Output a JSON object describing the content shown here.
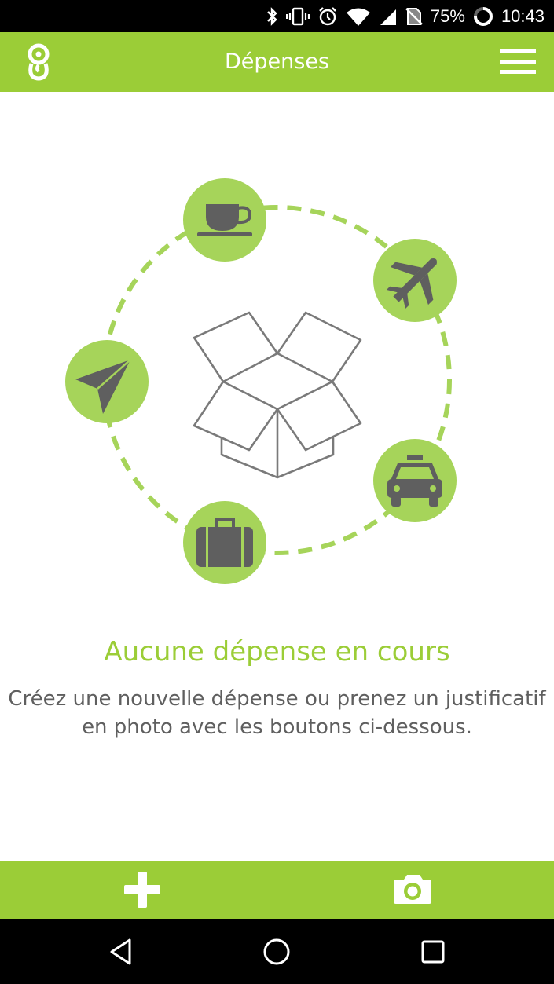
{
  "status_bar": {
    "battery_percent": "75%",
    "time": "10:43",
    "icons": [
      "bluetooth-icon",
      "vibrate-icon",
      "alarm-icon",
      "wifi-icon",
      "cellular-signal-icon",
      "no-sim-icon",
      "battery-icon"
    ]
  },
  "app_bar": {
    "title": "Dépenses",
    "logo_icon": "app-logo-icon",
    "menu_icon": "hamburger-menu-icon"
  },
  "illustration": {
    "center_icon": "open-box-icon",
    "category_icons": [
      "coffee-cup-icon",
      "airplane-icon",
      "taxi-icon",
      "suitcase-icon",
      "paper-plane-icon"
    ]
  },
  "empty_state": {
    "title": "Aucune dépense en cours",
    "message_line1": "Créez une nouvelle dépense ou prenez un justificatif",
    "message_line2": "en photo avec les boutons ci-dessous."
  },
  "actions": {
    "add_icon": "plus-icon",
    "camera_icon": "camera-icon"
  },
  "nav_bar": {
    "icons": [
      "back-icon",
      "home-icon",
      "recents-icon"
    ]
  },
  "colors": {
    "accent": "#9bcd37",
    "accent_light": "#a6d45a",
    "icon_gray": "#5f5f5f",
    "text_gray": "#5f5f5f",
    "white": "#ffffff",
    "black": "#000000"
  }
}
